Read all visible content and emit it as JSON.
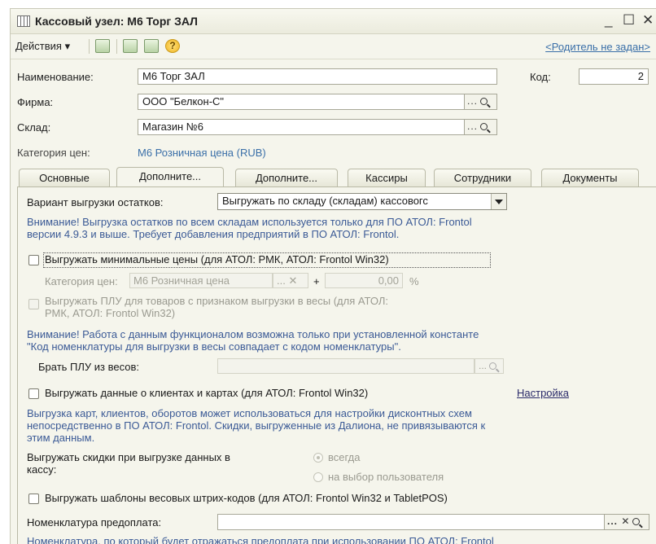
{
  "window": {
    "title": "Кассовый узел: М6 Торг ЗАЛ",
    "minimize": "_",
    "maximize": "☐",
    "close": "✕"
  },
  "toolbar": {
    "actions": "Действия ▾",
    "parent_link": "<Родитель не задан>",
    "help": "?"
  },
  "header": {
    "name_label": "Наименование:",
    "name_value": "М6 Торг ЗАЛ",
    "code_label": "Код:",
    "code_value": "2",
    "firm_label": "Фирма:",
    "firm_value": "ООО \"Белкон-С\"",
    "warehouse_label": "Склад:",
    "warehouse_value": "Магазин №6",
    "price_category_label": "Категория цен:",
    "price_category_value": "М6 Розничная цена (RUB)",
    "pick_buttons": "..."
  },
  "tabs": [
    {
      "label": "Основные"
    },
    {
      "label": "Дополните..."
    },
    {
      "label": "Дополните..."
    },
    {
      "label": "Кассиры"
    },
    {
      "label": "Сотрудники"
    },
    {
      "label": "Документы"
    }
  ],
  "panel": {
    "export_variant_label": "Вариант выгрузки остатков:",
    "export_variant_value": "Выгружать по складу (складам) кассовогс",
    "warning1_line1": "Внимание! Выгрузка остатков по всем складам используется только для ПО АТОЛ: Frontol",
    "warning1_line2": "версии 4.9.3 и выше. Требует добавления предприятий в ПО АТОЛ: Frontol.",
    "min_prices_label": "Выгружать минимальные цены (для АТОЛ: РМК, АТОЛ: Frontol Win32)",
    "min_price_category_label": "Категория цен:",
    "min_price_category_value": "М6 Розничная цена",
    "min_price_buttons": "... ✕",
    "plus": "+",
    "percent_value": "0,00",
    "percent_sign": "%",
    "plu_label_line1": "Выгружать ПЛУ для товаров с признаком выгрузки в весы (для АТОЛ:",
    "plu_label_line2": "РМК, АТОЛ: Frontol Win32)",
    "warning2_line1": "Внимание! Работа с данным функционалом возможна только при установленной константе",
    "warning2_line2": "\"Код номенклатуры для выгрузки в весы совпадает с кодом номенклатуры\".",
    "take_plu_label": "Брать ПЛУ из весов:",
    "take_plu_buttons": "...",
    "clients_label": "Выгружать данные о клиентах и картах (для АТОЛ: Frontol Win32)",
    "settings_link": "Настройка",
    "info3_line1": "Выгрузка карт, клиентов, оборотов может использоваться для настройки дисконтных схем",
    "info3_line2": "непосредственно в ПО АТОЛ: Frontol. Скидки, выгруженные из Далиона, не привязываются к",
    "info3_line3": "этим данным.",
    "discounts_label_line1": "Выгружать скидки при выгрузке данных в",
    "discounts_label_line2": "кассу:",
    "radio_always": "всегда",
    "radio_user_choice": "на выбор пользователя",
    "barcode_templates_label": "Выгружать шаблоны весовых штрих-кодов (для АТОЛ: Frontol Win32 и TabletPOS)",
    "prepay_label": "Номенклатура предоплата:",
    "prepay_value": "",
    "prepay_buttons": "... ✕",
    "bottom_info": "Номенклатура, по который будет отражаться предоплата при использовании ПО АТОЛ: Frontol"
  }
}
